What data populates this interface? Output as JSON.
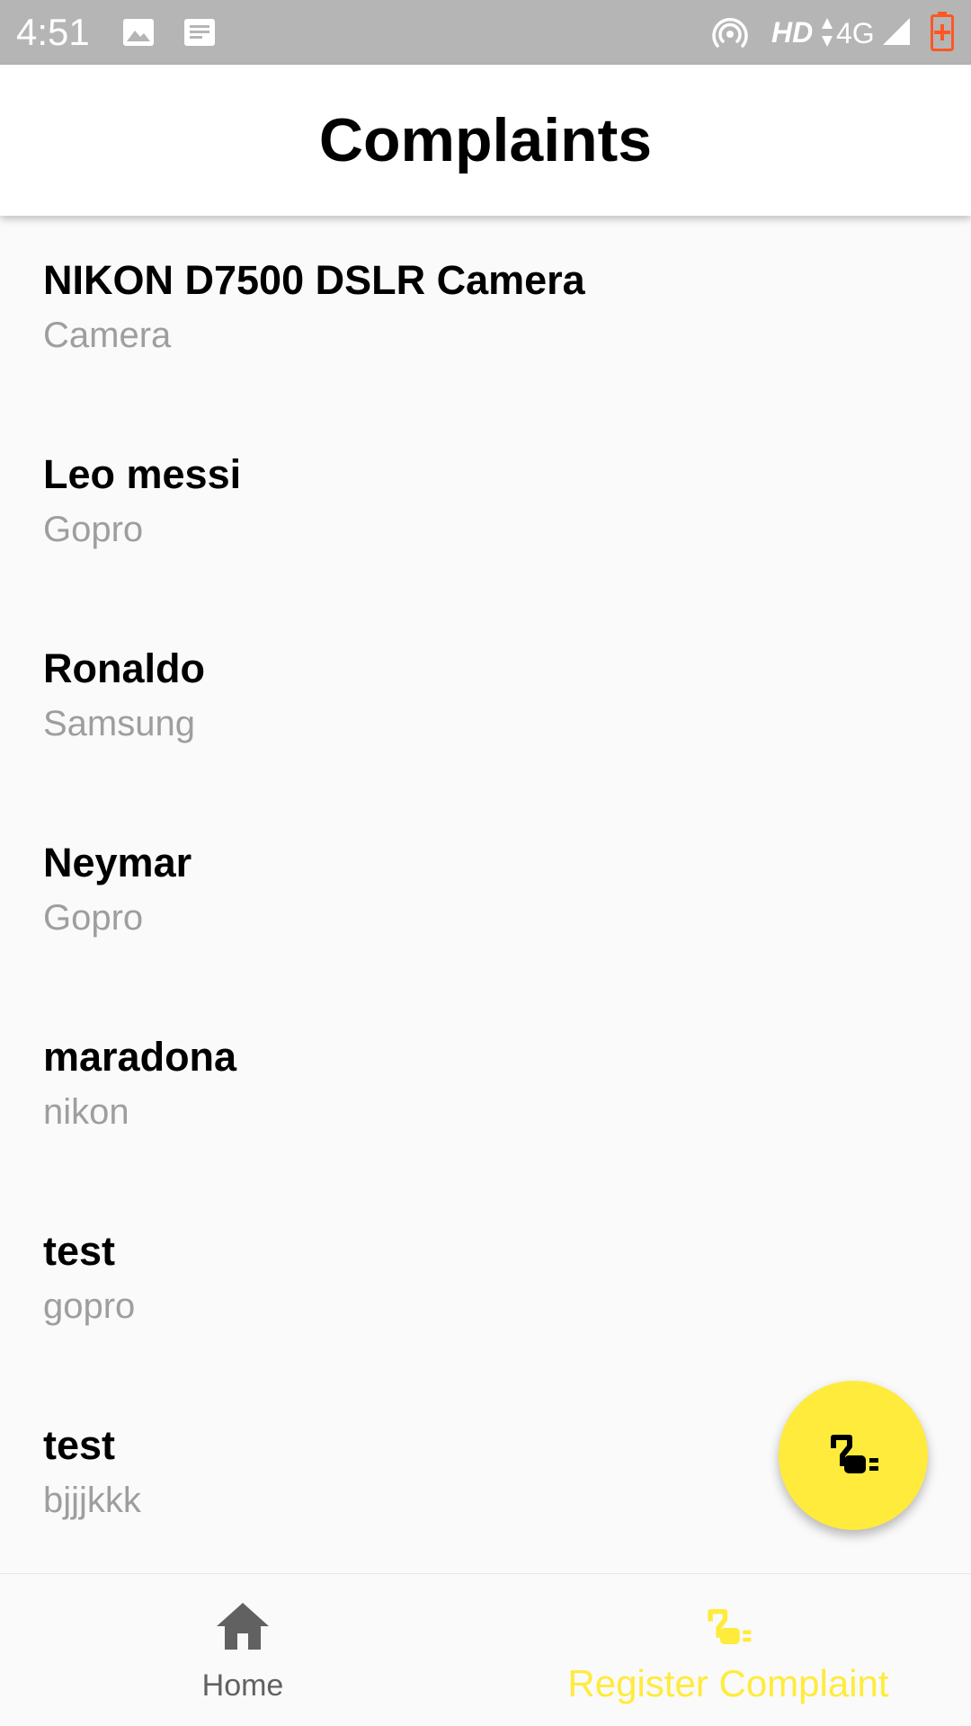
{
  "status_bar": {
    "time": "4:51",
    "network_hd": "HD",
    "network_type": "4G",
    "icons": [
      "image-icon",
      "message-icon",
      "hotspot-icon",
      "data-arrows-icon",
      "signal-icon",
      "battery-charging-icon"
    ]
  },
  "app_bar": {
    "title": "Complaints"
  },
  "complaints": [
    {
      "title": "NIKON D7500 DSLR Camera",
      "subtitle": "Camera"
    },
    {
      "title": "Leo messi",
      "subtitle": "Gopro"
    },
    {
      "title": "Ronaldo",
      "subtitle": "Samsung"
    },
    {
      "title": "Neymar",
      "subtitle": "Gopro"
    },
    {
      "title": "maradona",
      "subtitle": "nikon"
    },
    {
      "title": "test",
      "subtitle": "gopro"
    },
    {
      "title": "test",
      "subtitle": "bjjjkkk"
    }
  ],
  "fab": {
    "icon": "plug-icon"
  },
  "bottom_nav": {
    "home_label": "Home",
    "home_icon": "home-icon",
    "register_label": "Register Complaint",
    "register_icon": "plug-icon"
  },
  "colors": {
    "accent": "#ffeb3b",
    "status_bar": "#b5b5b5",
    "subtitle": "#9e9e9e",
    "battery": "#ff5722"
  }
}
